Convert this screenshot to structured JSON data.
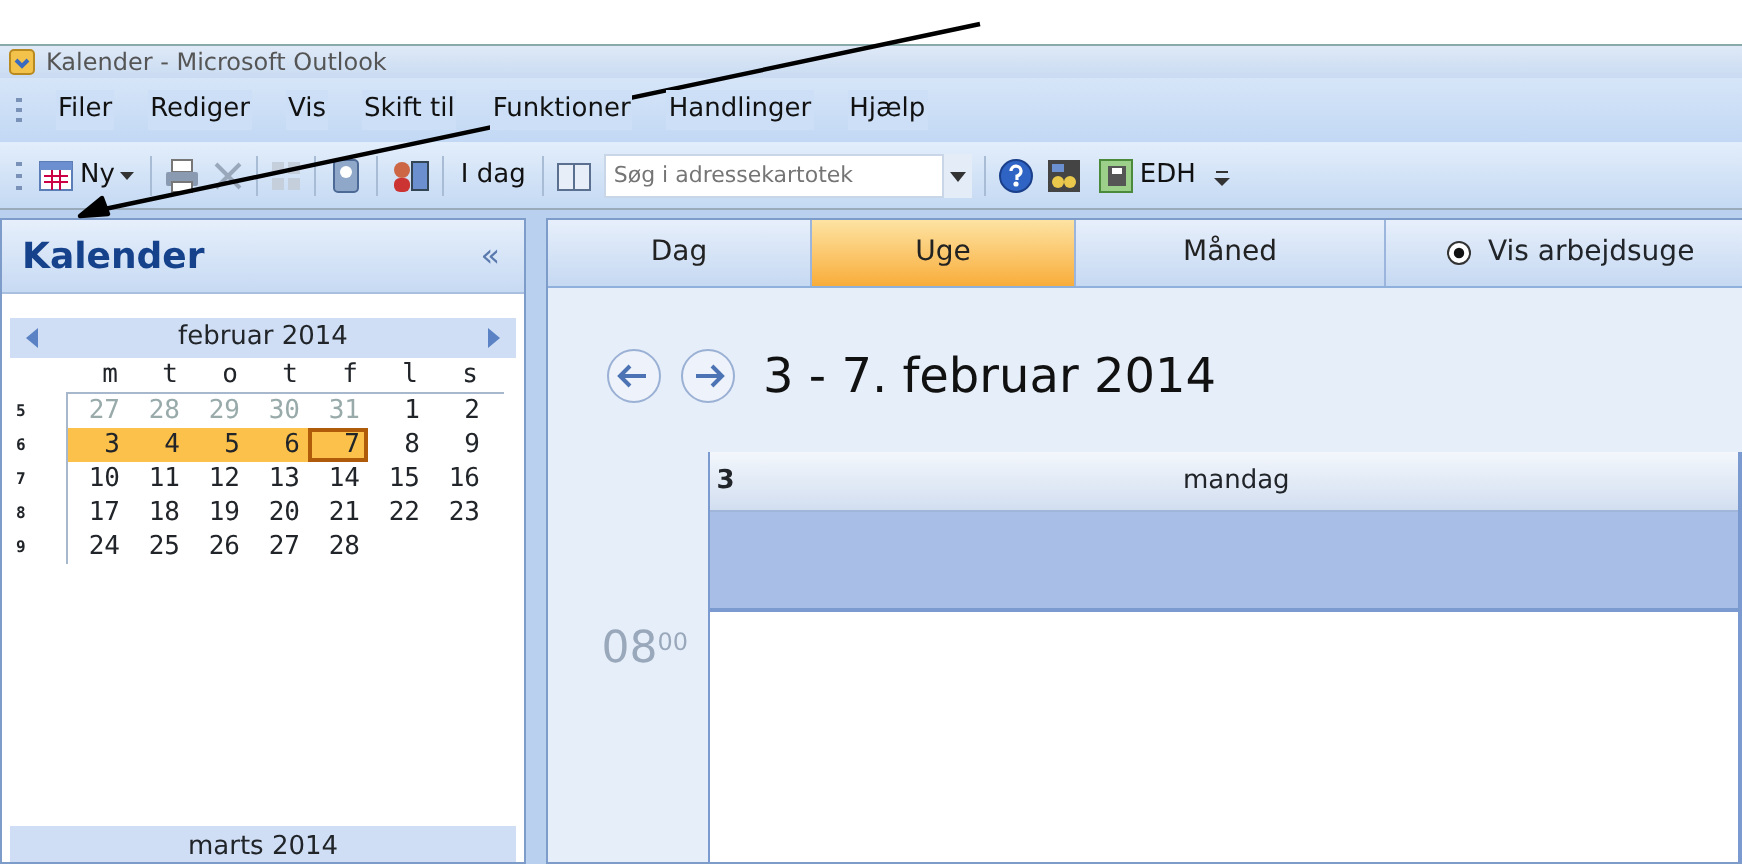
{
  "window": {
    "title": "Kalender - Microsoft Outlook"
  },
  "menu": [
    "Filer",
    "Rediger",
    "Vis",
    "Skift til",
    "Funktioner",
    "Handlinger",
    "Hjælp"
  ],
  "toolbar": {
    "new_label": "Ny",
    "today_label": "I dag",
    "search": {
      "placeholder": "Søg i adressekartotek"
    },
    "custom_label": "EDH"
  },
  "navigation": {
    "title": "Kalender",
    "collapse": "«",
    "month": {
      "title": "februar 2014",
      "weekdays": [
        "m",
        "t",
        "o",
        "t",
        "f",
        "l",
        "s"
      ],
      "weeks": [
        {
          "number": "5",
          "days": [
            {
              "day": "27",
              "muted": true,
              "selected": false,
              "today": false
            },
            {
              "day": "28",
              "muted": true,
              "selected": false,
              "today": false
            },
            {
              "day": "29",
              "muted": true,
              "selected": false,
              "today": false
            },
            {
              "day": "30",
              "muted": true,
              "selected": false,
              "today": false
            },
            {
              "day": "31",
              "muted": true,
              "selected": false,
              "today": false
            },
            {
              "day": "1",
              "muted": false,
              "selected": false,
              "today": false
            },
            {
              "day": "2",
              "muted": false,
              "selected": false,
              "today": false
            }
          ]
        },
        {
          "number": "6",
          "days": [
            {
              "day": "3",
              "muted": false,
              "selected": true,
              "today": false
            },
            {
              "day": "4",
              "muted": false,
              "selected": true,
              "today": false
            },
            {
              "day": "5",
              "muted": false,
              "selected": true,
              "today": false
            },
            {
              "day": "6",
              "muted": false,
              "selected": true,
              "today": false
            },
            {
              "day": "7",
              "muted": false,
              "selected": true,
              "today": true
            },
            {
              "day": "8",
              "muted": false,
              "selected": false,
              "today": false
            },
            {
              "day": "9",
              "muted": false,
              "selected": false,
              "today": false
            }
          ]
        },
        {
          "number": "7",
          "days": [
            {
              "day": "10",
              "muted": false,
              "selected": false,
              "today": false
            },
            {
              "day": "11",
              "muted": false,
              "selected": false,
              "today": false
            },
            {
              "day": "12",
              "muted": false,
              "selected": false,
              "today": false
            },
            {
              "day": "13",
              "muted": false,
              "selected": false,
              "today": false
            },
            {
              "day": "14",
              "muted": false,
              "selected": false,
              "today": false
            },
            {
              "day": "15",
              "muted": false,
              "selected": false,
              "today": false
            },
            {
              "day": "16",
              "muted": false,
              "selected": false,
              "today": false
            }
          ]
        },
        {
          "number": "8",
          "days": [
            {
              "day": "17",
              "muted": false,
              "selected": false,
              "today": false
            },
            {
              "day": "18",
              "muted": false,
              "selected": false,
              "today": false
            },
            {
              "day": "19",
              "muted": false,
              "selected": false,
              "today": false
            },
            {
              "day": "20",
              "muted": false,
              "selected": false,
              "today": false
            },
            {
              "day": "21",
              "muted": false,
              "selected": false,
              "today": false
            },
            {
              "day": "22",
              "muted": false,
              "selected": false,
              "today": false
            },
            {
              "day": "23",
              "muted": false,
              "selected": false,
              "today": false
            }
          ]
        },
        {
          "number": "9",
          "days": [
            {
              "day": "24",
              "muted": false,
              "selected": false,
              "today": false
            },
            {
              "day": "25",
              "muted": false,
              "selected": false,
              "today": false
            },
            {
              "day": "26",
              "muted": false,
              "selected": false,
              "today": false
            },
            {
              "day": "27",
              "muted": false,
              "selected": false,
              "today": false
            },
            {
              "day": "28",
              "muted": false,
              "selected": false,
              "today": false
            }
          ]
        }
      ]
    },
    "next_month": "marts 2014"
  },
  "view": {
    "tabs": [
      {
        "label": "Dag",
        "selected": false
      },
      {
        "label": "Uge",
        "selected": true
      },
      {
        "label": "Måned",
        "selected": false
      }
    ],
    "option": {
      "label": "Vis arbejdsuge",
      "checked": true
    },
    "range_title": "3 - 7. februar 2014",
    "day_column": {
      "number": "3",
      "weekday": "mandag"
    },
    "time_slot": "08$^{00}$"
  }
}
